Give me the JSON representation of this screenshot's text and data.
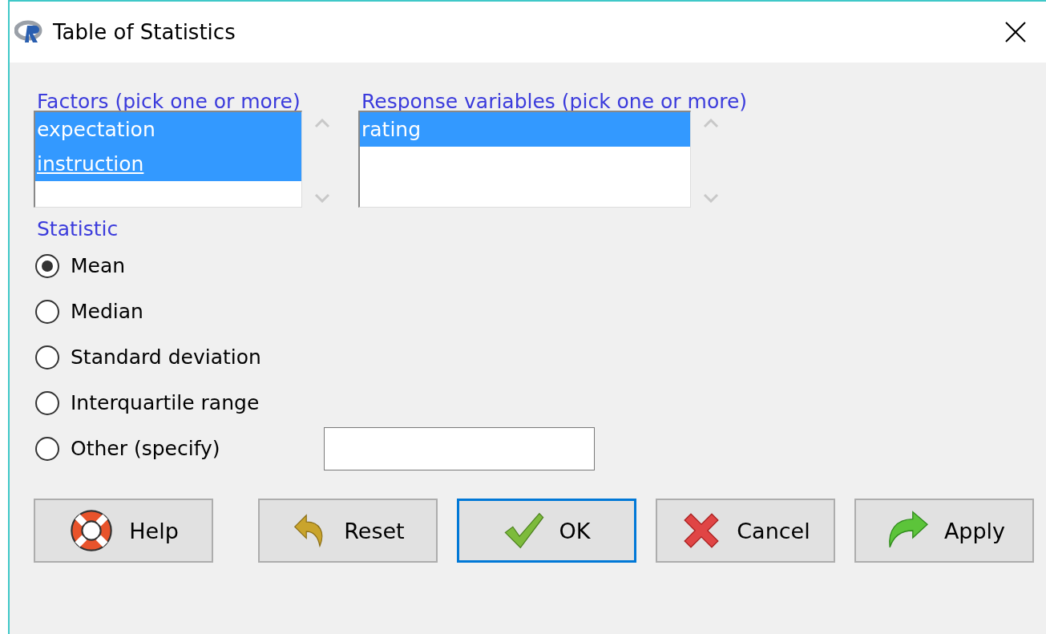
{
  "window": {
    "title": "Table of Statistics"
  },
  "lists": [
    {
      "label": "Factors (pick one or more)",
      "items": [
        {
          "label": "expectation",
          "selected": true,
          "focused": false
        },
        {
          "label": "instruction",
          "selected": true,
          "focused": true
        }
      ]
    },
    {
      "label": "Response variables (pick one or more)",
      "items": [
        {
          "label": "rating",
          "selected": true,
          "focused": false
        }
      ]
    }
  ],
  "statistic": {
    "label": "Statistic",
    "options": [
      {
        "label": "Mean",
        "selected": true
      },
      {
        "label": "Median",
        "selected": false
      },
      {
        "label": "Standard deviation",
        "selected": false
      },
      {
        "label": "Interquartile range",
        "selected": false
      },
      {
        "label": "Other (specify)",
        "selected": false
      }
    ]
  },
  "buttons": [
    {
      "label": "Help",
      "kind": "help",
      "focused": false
    },
    {
      "label": "Reset",
      "kind": "reset",
      "focused": false
    },
    {
      "label": "OK",
      "kind": "ok",
      "focused": true
    },
    {
      "label": "Cancel",
      "kind": "cancel",
      "focused": false
    },
    {
      "label": "Apply",
      "kind": "apply",
      "focused": false
    }
  ]
}
